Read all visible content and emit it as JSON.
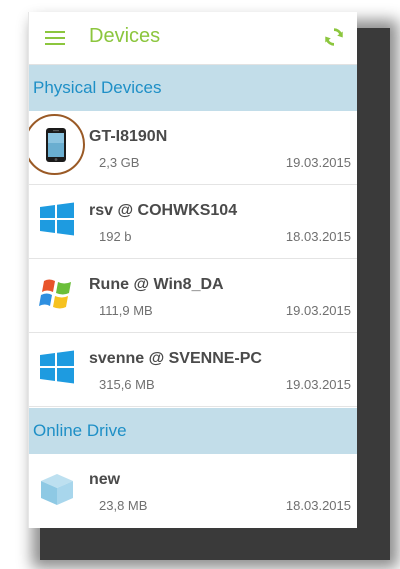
{
  "header": {
    "title": "Devices",
    "menu_icon": "hamburger-menu-icon",
    "refresh_icon": "refresh-sync-icon",
    "accent_color": "#8cc63e"
  },
  "sections": {
    "physical": {
      "label": "Physical Devices",
      "items": [
        {
          "name": "GT-I8190N",
          "size": "2,3 GB",
          "date": "19.03.2015",
          "icon": "smartphone-icon"
        },
        {
          "name": "rsv @ COHWKS104",
          "size": "192 b",
          "date": "18.03.2015",
          "icon": "windows-8-logo-icon"
        },
        {
          "name": "Rune @ Win8_DA",
          "size": "111,9 MB",
          "date": "19.03.2015",
          "icon": "windows-xp-logo-icon"
        },
        {
          "name": "svenne @ SVENNE-PC",
          "size": "315,6 MB",
          "date": "19.03.2015",
          "icon": "windows-8-logo-icon"
        }
      ]
    },
    "online": {
      "label": "Online Drive",
      "items": [
        {
          "name": "new",
          "size": "23,8 MB",
          "date": "18.03.2015",
          "icon": "cloud-drive-box-icon"
        }
      ]
    }
  },
  "colors": {
    "section_bg": "#c2dde9",
    "section_text": "#1e8fc6",
    "highlight_ring": "#9a5a26"
  }
}
